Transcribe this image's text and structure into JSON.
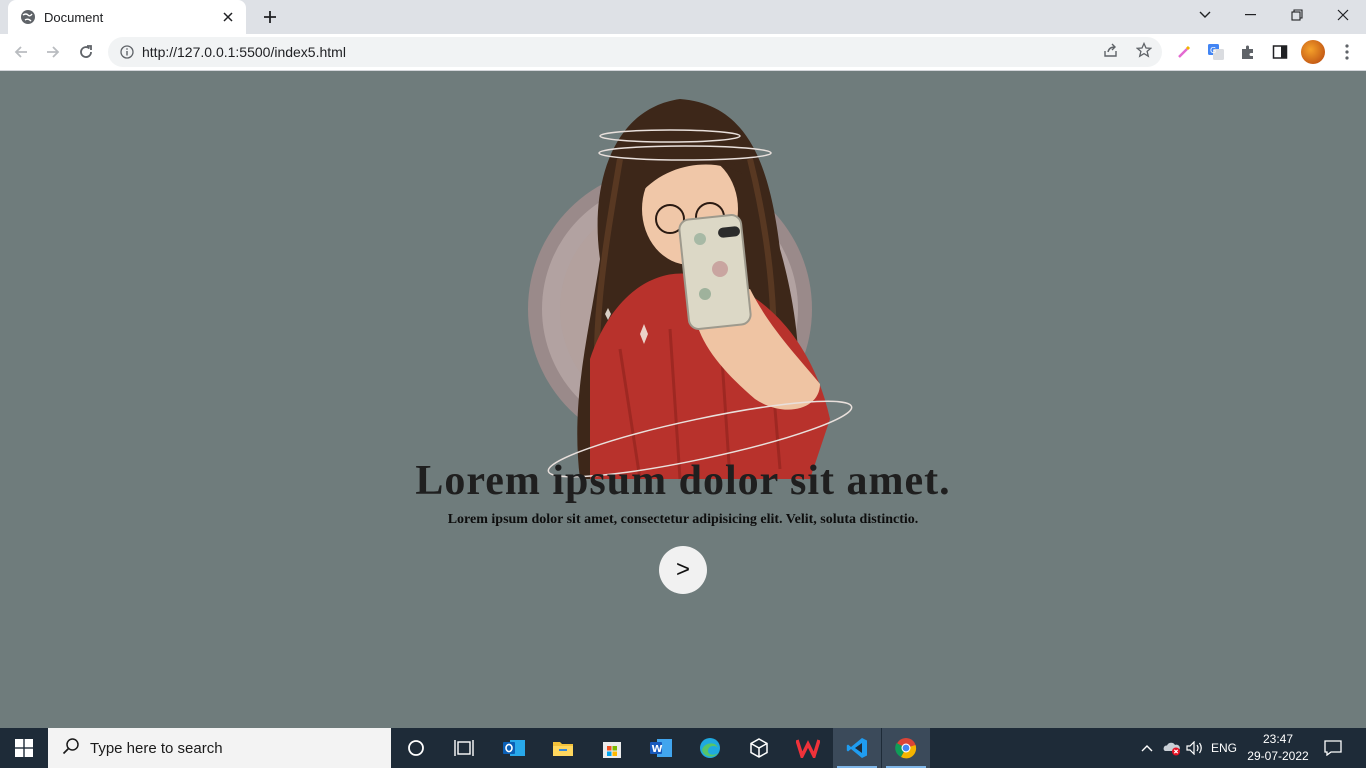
{
  "browser": {
    "tab_title": "Document",
    "url": "http://127.0.0.1:5500/index5.html"
  },
  "page": {
    "headline": "Lorem ipsum dolor sit amet.",
    "subline": "Lorem ipsum dolor sit amet, consectetur adipisicing elit. Velit, soluta distinctio.",
    "next_button_label": ">"
  },
  "taskbar": {
    "search_placeholder": "Type here to search",
    "language": "ENG",
    "time": "23:47",
    "date": "29-07-2022"
  },
  "colors": {
    "page_background": "#6f7c7c",
    "taskbar": "#1e2b38",
    "tabbar": "#dee1e6"
  }
}
